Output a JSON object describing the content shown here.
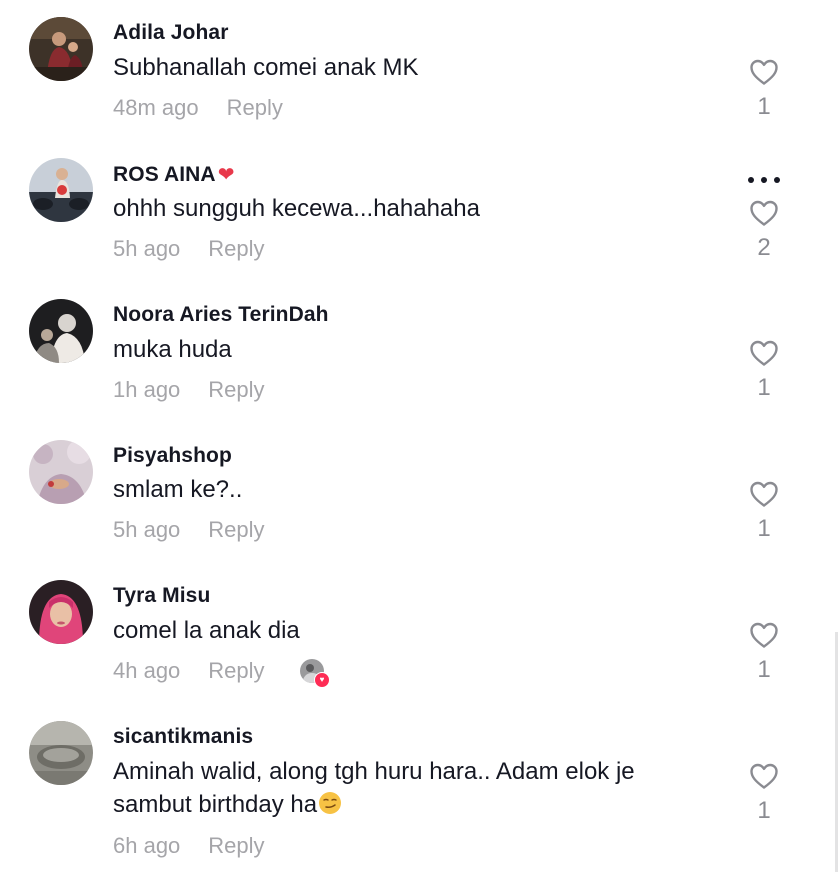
{
  "comments": [
    {
      "username": "Adila Johar",
      "text": "Subhanallah comei anak MK",
      "time": "48m ago",
      "reply_label": "Reply",
      "likes": "1",
      "avatar_icon": "user-avatar-photo"
    },
    {
      "username": "ROS AINA",
      "username_suffix": "❤️",
      "text": "ohhh sungguh kecewa...hahahaha",
      "time": "5h ago",
      "reply_label": "Reply",
      "likes": "2",
      "has_more_menu": true,
      "avatar_icon": "user-avatar-photo"
    },
    {
      "username": "Noora Aries TerinDah",
      "text": "muka huda",
      "time": "1h ago",
      "reply_label": "Reply",
      "likes": "1",
      "avatar_icon": "user-avatar-photo"
    },
    {
      "username": "Pisyahshop",
      "text": "smlam ke?..",
      "time": "5h ago",
      "reply_label": "Reply",
      "likes": "1",
      "avatar_icon": "user-avatar-photo"
    },
    {
      "username": "Tyra Misu",
      "text": "comel la anak dia",
      "time": "4h ago",
      "reply_label": "Reply",
      "likes": "1",
      "liked_by_creator": true,
      "avatar_icon": "user-avatar-photo"
    },
    {
      "username": "sicantikmanis",
      "text_line1": "Aminah walid, along tgh huru hara.. Adam elok je",
      "text_line2": "sambut birthday ha",
      "text_emoji": "smirking-face-emoji",
      "time": "6h ago",
      "reply_label": "Reply",
      "likes": "1",
      "avatar_icon": "user-avatar-photo"
    }
  ],
  "colors": {
    "text_primary": "#161823",
    "text_secondary": "#a5a5a9",
    "like_count": "#8a8b91",
    "heart_red": "#fe2c55"
  }
}
